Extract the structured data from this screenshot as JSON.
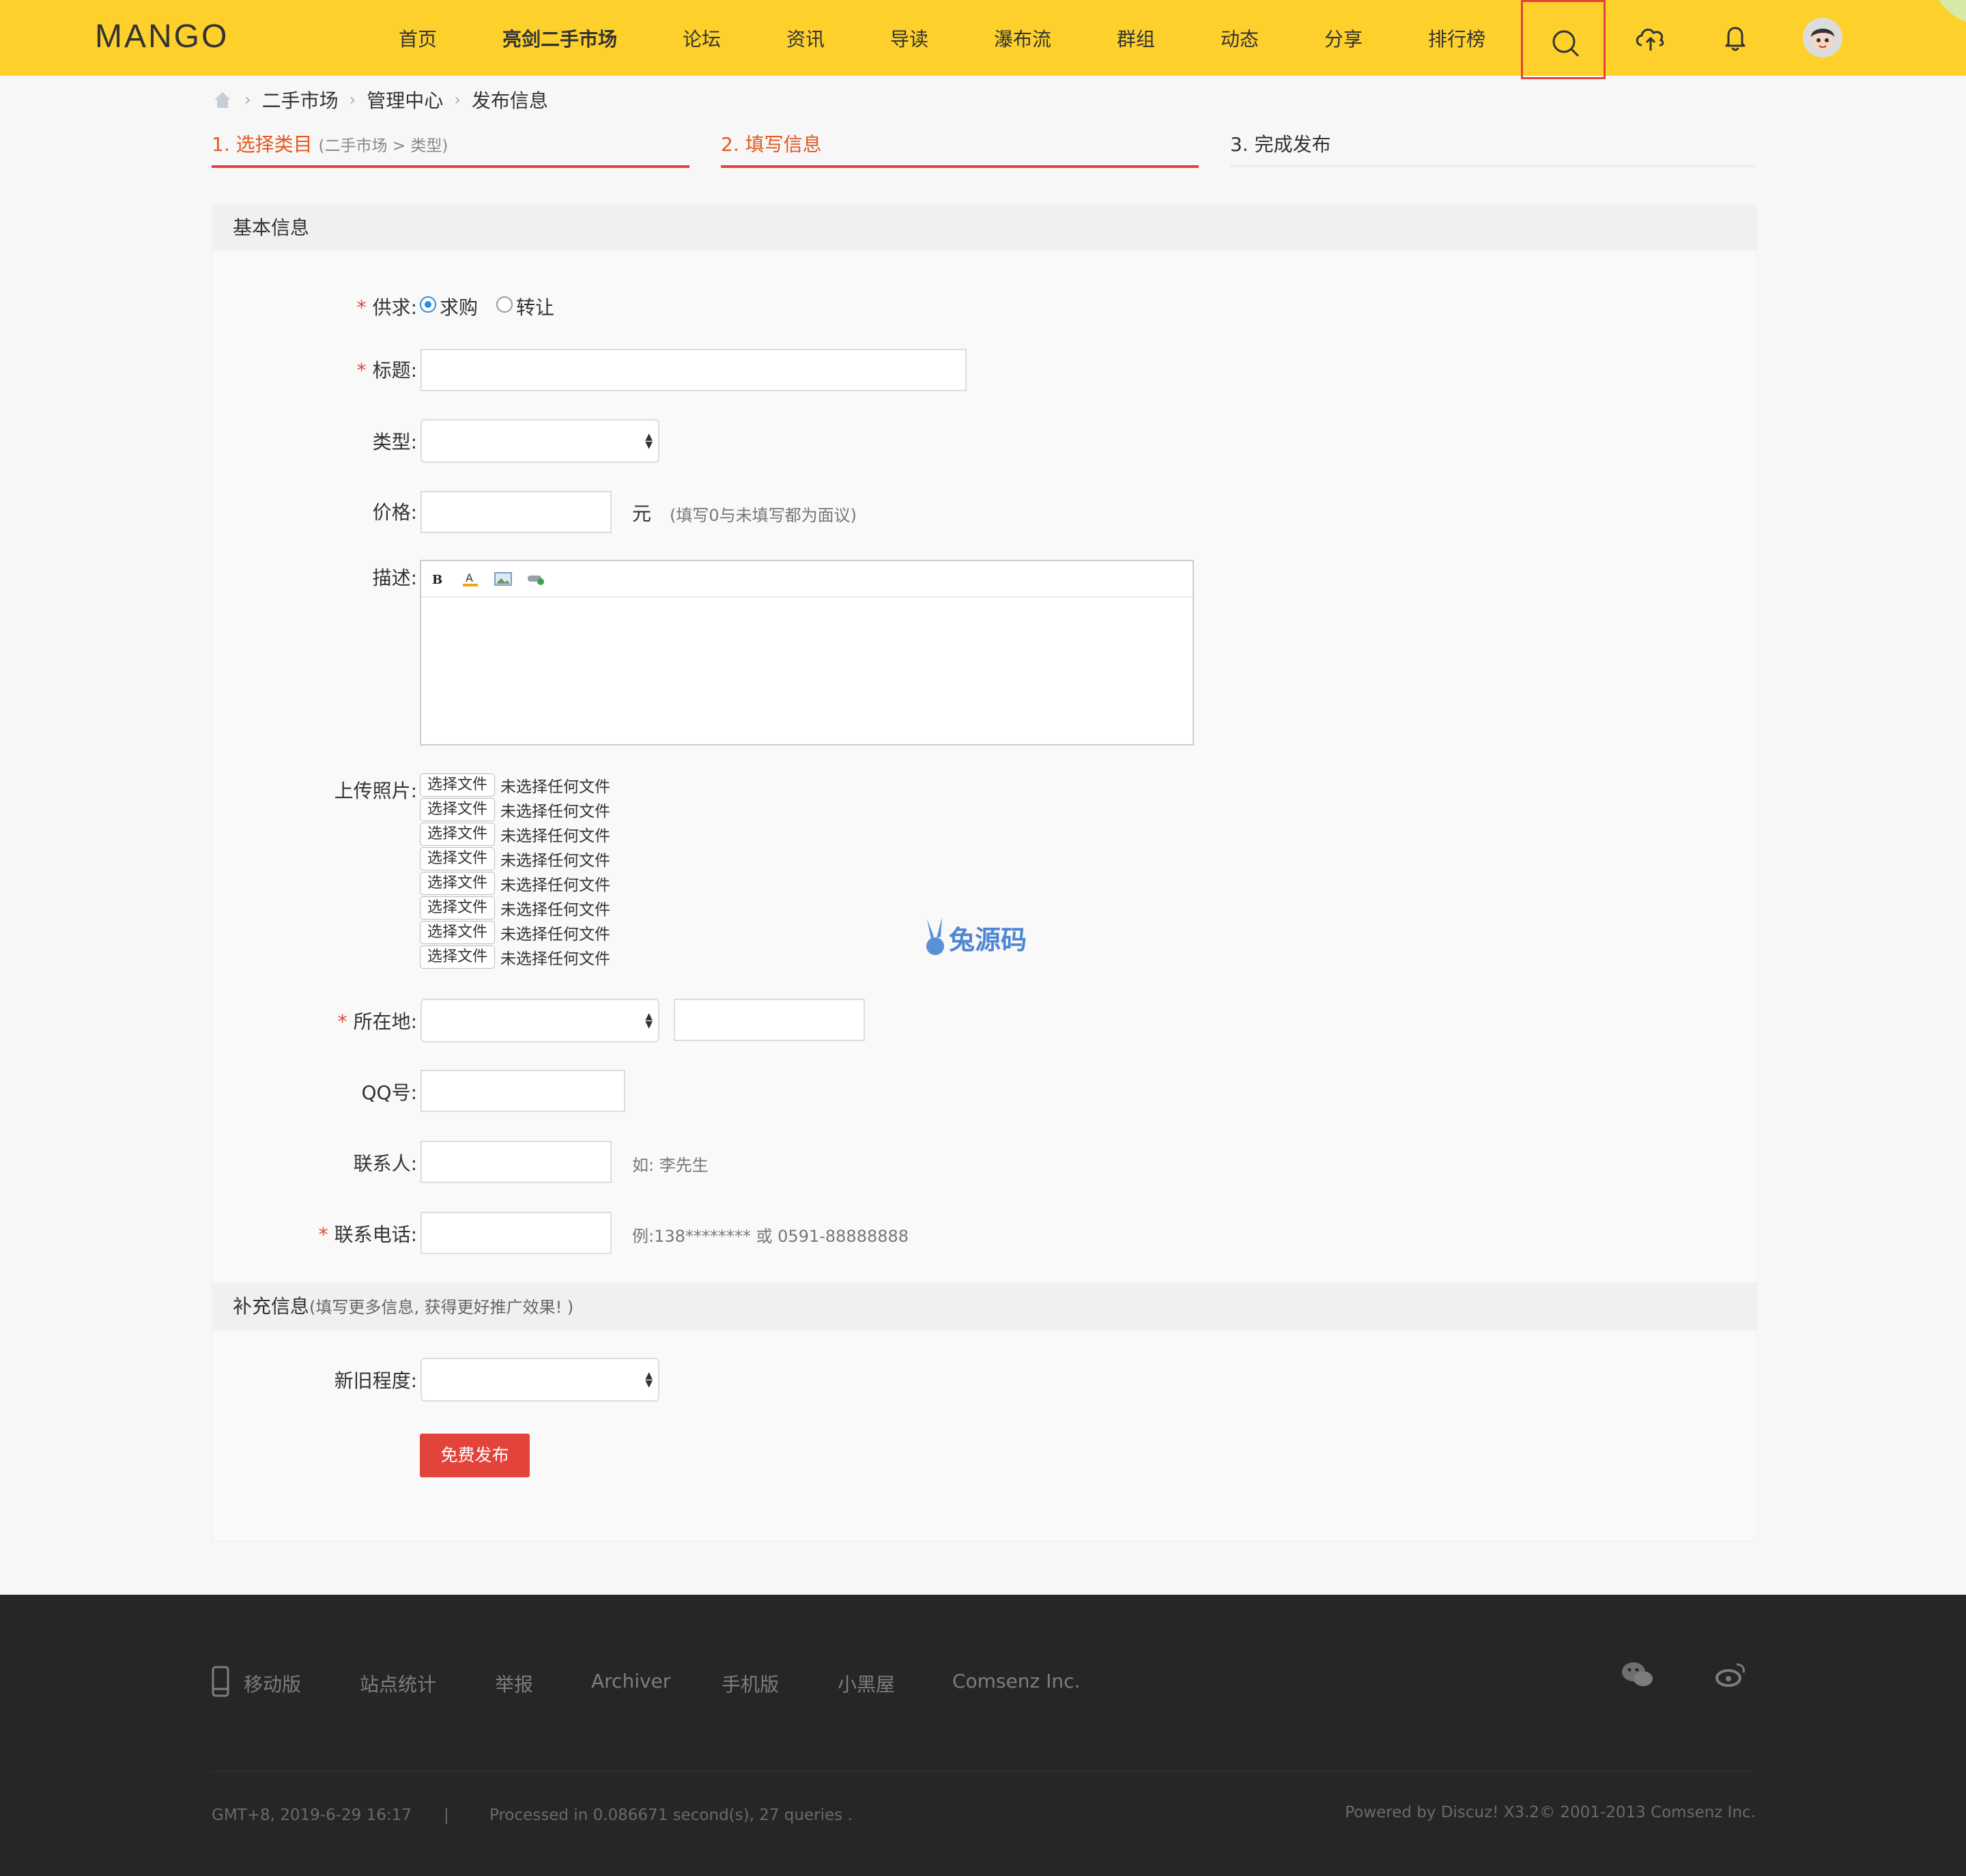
{
  "header": {
    "logo": "MANGO",
    "nav": [
      "首页",
      "亮剑二手市场",
      "论坛",
      "资讯",
      "导读",
      "瀑布流",
      "群组",
      "动态",
      "分享",
      "排行榜"
    ],
    "icons": [
      "search-icon",
      "upload-icon",
      "bell-icon",
      "avatar"
    ],
    "accent_color": "#fdd02b"
  },
  "breadcrumb": [
    "二手市场",
    "管理中心",
    "发布信息"
  ],
  "steps": {
    "step1": "1. 选择类目",
    "step1_sub": "(二手市场 > 类型)",
    "step2": "2. 填写信息",
    "step3": "3. 完成发布"
  },
  "form": {
    "basic_section": "基本信息",
    "supply_label": "供求:",
    "supply_options": [
      "求购",
      "转让"
    ],
    "supply_selected": "求购",
    "title_label": "标题:",
    "type_label": "类型:",
    "price_label": "价格:",
    "price_unit": "元",
    "price_hint": "(填写0与未填写都为面议)",
    "desc_label": "描述:",
    "upload_label": "上传照片:",
    "file_button": "选择文件",
    "file_status": "未选择任何文件",
    "file_count": 8,
    "location_label": "所在地:",
    "qq_label": "QQ号:",
    "contact_label": "联系人:",
    "contact_hint": "如: 李先生",
    "phone_label": "联系电话:",
    "phone_hint": "例:138******** 或 0591-88888888",
    "extra_section": "补充信息",
    "extra_note": "(填写更多信息, 获得更好推广效果! )",
    "condition_label": "新旧程度:",
    "submit": "免费发布",
    "required_mark": "*"
  },
  "watermark": "兔源码",
  "footer": {
    "links": [
      "移动版",
      "站点统计",
      "举报",
      "Archiver",
      "手机版",
      "小黑屋",
      "Comsenz Inc."
    ],
    "timezone": "GMT+8, 2019-6-29 16:17",
    "divider": "|",
    "processed": "Processed in 0.086671 second(s), 27 queries .",
    "powered": "Powered by Discuz! X3.2© 2001-2013 Comsenz Inc."
  }
}
